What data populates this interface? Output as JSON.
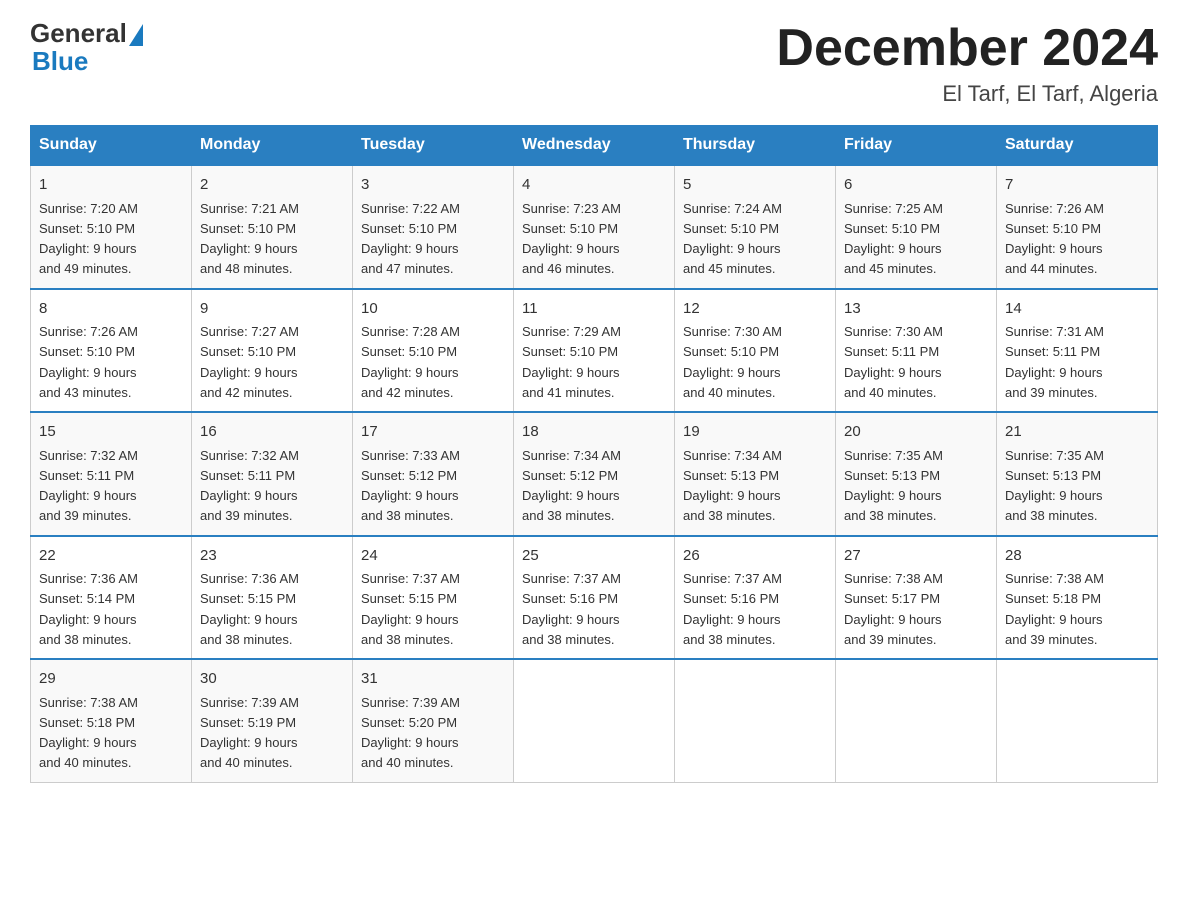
{
  "header": {
    "logo_text_general": "General",
    "logo_text_blue": "Blue",
    "month_year": "December 2024",
    "location": "El Tarf, El Tarf, Algeria"
  },
  "days_of_week": [
    "Sunday",
    "Monday",
    "Tuesday",
    "Wednesday",
    "Thursday",
    "Friday",
    "Saturday"
  ],
  "weeks": [
    [
      {
        "day": "1",
        "sunrise": "7:20 AM",
        "sunset": "5:10 PM",
        "daylight": "9 hours and 49 minutes."
      },
      {
        "day": "2",
        "sunrise": "7:21 AM",
        "sunset": "5:10 PM",
        "daylight": "9 hours and 48 minutes."
      },
      {
        "day": "3",
        "sunrise": "7:22 AM",
        "sunset": "5:10 PM",
        "daylight": "9 hours and 47 minutes."
      },
      {
        "day": "4",
        "sunrise": "7:23 AM",
        "sunset": "5:10 PM",
        "daylight": "9 hours and 46 minutes."
      },
      {
        "day": "5",
        "sunrise": "7:24 AM",
        "sunset": "5:10 PM",
        "daylight": "9 hours and 45 minutes."
      },
      {
        "day": "6",
        "sunrise": "7:25 AM",
        "sunset": "5:10 PM",
        "daylight": "9 hours and 45 minutes."
      },
      {
        "day": "7",
        "sunrise": "7:26 AM",
        "sunset": "5:10 PM",
        "daylight": "9 hours and 44 minutes."
      }
    ],
    [
      {
        "day": "8",
        "sunrise": "7:26 AM",
        "sunset": "5:10 PM",
        "daylight": "9 hours and 43 minutes."
      },
      {
        "day": "9",
        "sunrise": "7:27 AM",
        "sunset": "5:10 PM",
        "daylight": "9 hours and 42 minutes."
      },
      {
        "day": "10",
        "sunrise": "7:28 AM",
        "sunset": "5:10 PM",
        "daylight": "9 hours and 42 minutes."
      },
      {
        "day": "11",
        "sunrise": "7:29 AM",
        "sunset": "5:10 PM",
        "daylight": "9 hours and 41 minutes."
      },
      {
        "day": "12",
        "sunrise": "7:30 AM",
        "sunset": "5:10 PM",
        "daylight": "9 hours and 40 minutes."
      },
      {
        "day": "13",
        "sunrise": "7:30 AM",
        "sunset": "5:11 PM",
        "daylight": "9 hours and 40 minutes."
      },
      {
        "day": "14",
        "sunrise": "7:31 AM",
        "sunset": "5:11 PM",
        "daylight": "9 hours and 39 minutes."
      }
    ],
    [
      {
        "day": "15",
        "sunrise": "7:32 AM",
        "sunset": "5:11 PM",
        "daylight": "9 hours and 39 minutes."
      },
      {
        "day": "16",
        "sunrise": "7:32 AM",
        "sunset": "5:11 PM",
        "daylight": "9 hours and 39 minutes."
      },
      {
        "day": "17",
        "sunrise": "7:33 AM",
        "sunset": "5:12 PM",
        "daylight": "9 hours and 38 minutes."
      },
      {
        "day": "18",
        "sunrise": "7:34 AM",
        "sunset": "5:12 PM",
        "daylight": "9 hours and 38 minutes."
      },
      {
        "day": "19",
        "sunrise": "7:34 AM",
        "sunset": "5:13 PM",
        "daylight": "9 hours and 38 minutes."
      },
      {
        "day": "20",
        "sunrise": "7:35 AM",
        "sunset": "5:13 PM",
        "daylight": "9 hours and 38 minutes."
      },
      {
        "day": "21",
        "sunrise": "7:35 AM",
        "sunset": "5:13 PM",
        "daylight": "9 hours and 38 minutes."
      }
    ],
    [
      {
        "day": "22",
        "sunrise": "7:36 AM",
        "sunset": "5:14 PM",
        "daylight": "9 hours and 38 minutes."
      },
      {
        "day": "23",
        "sunrise": "7:36 AM",
        "sunset": "5:15 PM",
        "daylight": "9 hours and 38 minutes."
      },
      {
        "day": "24",
        "sunrise": "7:37 AM",
        "sunset": "5:15 PM",
        "daylight": "9 hours and 38 minutes."
      },
      {
        "day": "25",
        "sunrise": "7:37 AM",
        "sunset": "5:16 PM",
        "daylight": "9 hours and 38 minutes."
      },
      {
        "day": "26",
        "sunrise": "7:37 AM",
        "sunset": "5:16 PM",
        "daylight": "9 hours and 38 minutes."
      },
      {
        "day": "27",
        "sunrise": "7:38 AM",
        "sunset": "5:17 PM",
        "daylight": "9 hours and 39 minutes."
      },
      {
        "day": "28",
        "sunrise": "7:38 AM",
        "sunset": "5:18 PM",
        "daylight": "9 hours and 39 minutes."
      }
    ],
    [
      {
        "day": "29",
        "sunrise": "7:38 AM",
        "sunset": "5:18 PM",
        "daylight": "9 hours and 40 minutes."
      },
      {
        "day": "30",
        "sunrise": "7:39 AM",
        "sunset": "5:19 PM",
        "daylight": "9 hours and 40 minutes."
      },
      {
        "day": "31",
        "sunrise": "7:39 AM",
        "sunset": "5:20 PM",
        "daylight": "9 hours and 40 minutes."
      },
      null,
      null,
      null,
      null
    ]
  ],
  "labels": {
    "sunrise": "Sunrise:",
    "sunset": "Sunset:",
    "daylight": "Daylight:"
  }
}
